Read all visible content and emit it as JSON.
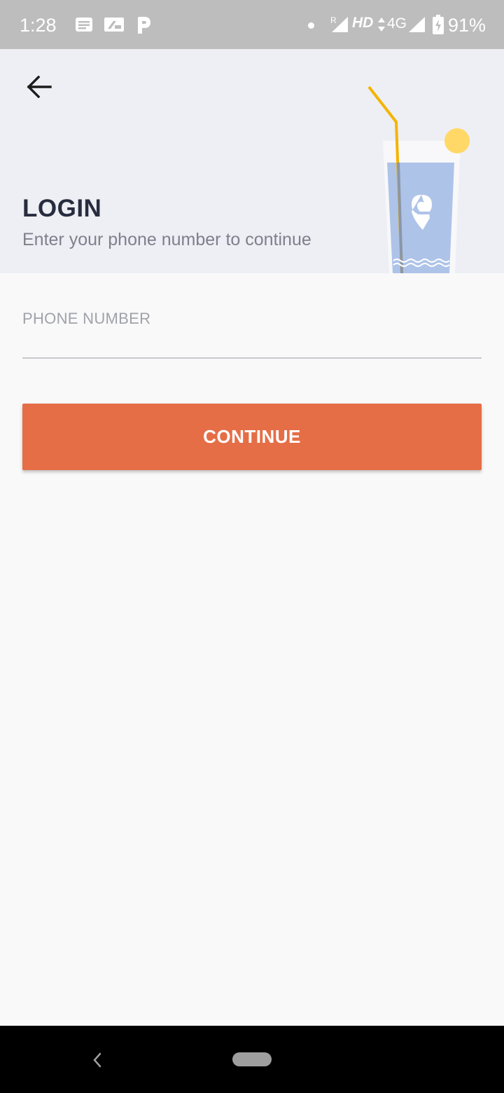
{
  "status_bar": {
    "time": "1:28",
    "network_badge": "R",
    "hd_label": "HD",
    "network_type": "4G",
    "battery_percent": "91%",
    "notification_icons": [
      "message-icon",
      "sim-card-icon",
      "parking-app-icon"
    ]
  },
  "header": {
    "back_icon": "arrow-left-icon",
    "title": "LOGIN",
    "subtitle": "Enter your phone number to continue",
    "illustration": "drink-glass-illustration"
  },
  "form": {
    "phone_label": "PHONE NUMBER",
    "phone_value": "",
    "continue_label": "CONTINUE"
  },
  "colors": {
    "status_bar_bg": "#bdbdbd",
    "header_bg": "#eeeff4",
    "page_bg": "#f9f9f9",
    "title": "#282c3f",
    "subtitle": "#7e808c",
    "accent": "#e56e47",
    "glass_liquid": "#aec3e8",
    "straw": "#f4b400",
    "lemon": "#ffd868"
  },
  "nav_bar": {
    "back_icon": "nav-back-chevron-icon",
    "home_icon": "nav-home-pill-icon"
  }
}
